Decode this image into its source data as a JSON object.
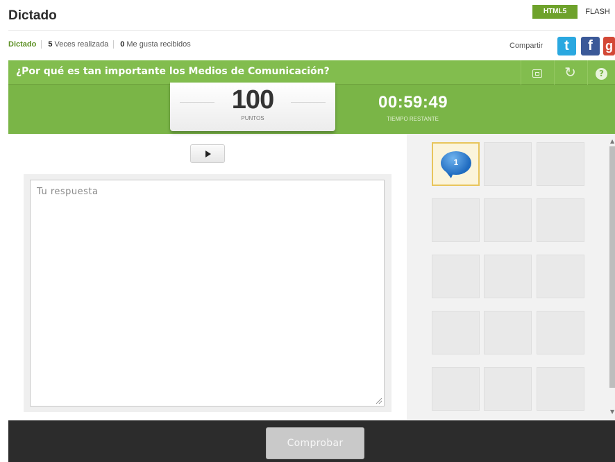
{
  "header": {
    "title": "Dictado",
    "format_html5": "HTML5",
    "format_flash": "FLASH"
  },
  "stats": {
    "link": "Dictado",
    "times_count": "5",
    "times_label": "Veces realizada",
    "likes_count": "0",
    "likes_label": "Me gusta recibidos"
  },
  "share": {
    "label": "Compartir",
    "twitter_glyph": "t",
    "facebook_glyph": "f",
    "google_glyph": "g"
  },
  "question": {
    "text": "¿Por qué es tan importante los Medios de Comunicación?",
    "tool_icons": [
      "picture-icon",
      "refresh-icon",
      "help-icon"
    ],
    "refresh_glyph": "↻",
    "help_glyph": "?"
  },
  "score": {
    "value": "100",
    "label": "PUNTOS"
  },
  "timer": {
    "value": "00:59:49",
    "label": "TIEMPO RESTANTE"
  },
  "answer": {
    "placeholder": "Tu respuesta",
    "value": ""
  },
  "tiles": {
    "active_number": "1",
    "count": 15
  },
  "footer": {
    "check_label": "Comprobar"
  },
  "colors": {
    "accent_green": "#7ab547",
    "html5_badge": "#6ea22b",
    "footer_bg": "#2c2c2c",
    "active_tile_border": "#e8c55c"
  }
}
